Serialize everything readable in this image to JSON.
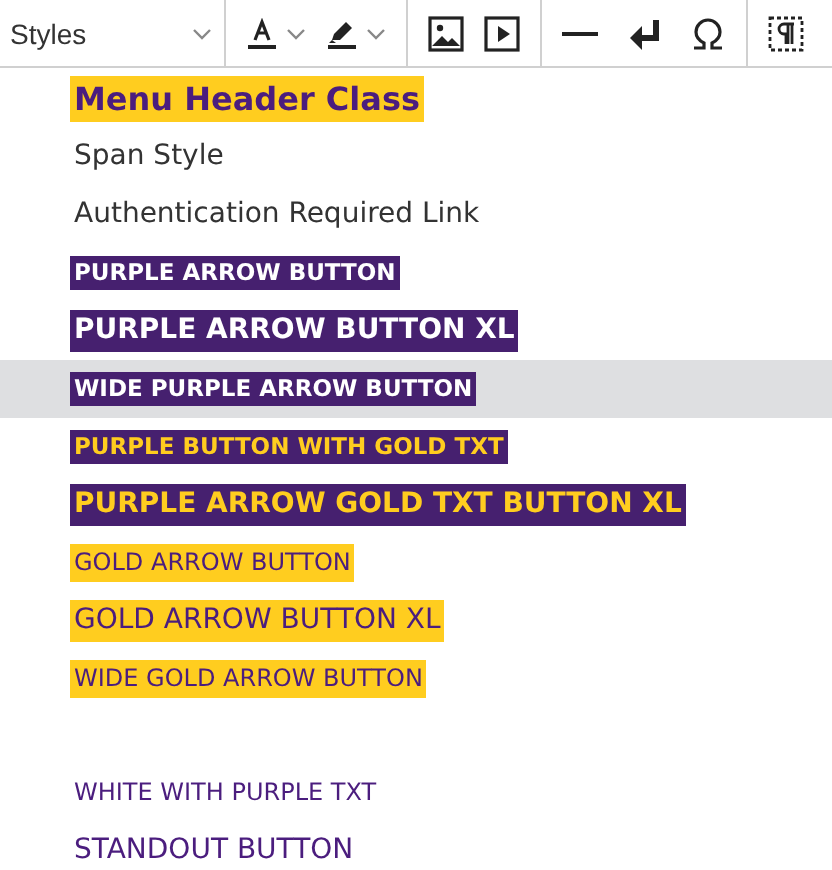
{
  "toolbar": {
    "styles_label": "Styles"
  },
  "styles_menu": [
    {
      "label": "Menu Header Class",
      "kind": "header",
      "selected": false
    },
    {
      "label": "Span Style",
      "kind": "plain",
      "selected": false
    },
    {
      "label": "Authentication Required Link",
      "kind": "plain",
      "selected": false
    },
    {
      "label": "PURPLE ARROW BUTTON",
      "kind": "purple",
      "selected": false
    },
    {
      "label": "PURPLE ARROW BUTTON XL",
      "kind": "purple-xl",
      "selected": false
    },
    {
      "label": "WIDE PURPLE ARROW BUTTON",
      "kind": "purple",
      "selected": true
    },
    {
      "label": "PURPLE BUTTON WITH GOLD TXT",
      "kind": "purple-gold",
      "selected": false
    },
    {
      "label": "PURPLE ARROW GOLD TXT BUTTON XL",
      "kind": "purple-gold-xl",
      "selected": false
    },
    {
      "label": "GOLD ARROW BUTTON",
      "kind": "gold",
      "selected": false
    },
    {
      "label": "GOLD ARROW BUTTON XL",
      "kind": "gold-xl",
      "selected": false
    },
    {
      "label": "WIDE GOLD ARROW BUTTON",
      "kind": "gold",
      "selected": false
    },
    {
      "label": "WHITE WITH PURPLE TXT",
      "kind": "white-purple",
      "selected": false
    },
    {
      "label": "STANDOUT BUTTON",
      "kind": "standout",
      "selected": false
    }
  ]
}
